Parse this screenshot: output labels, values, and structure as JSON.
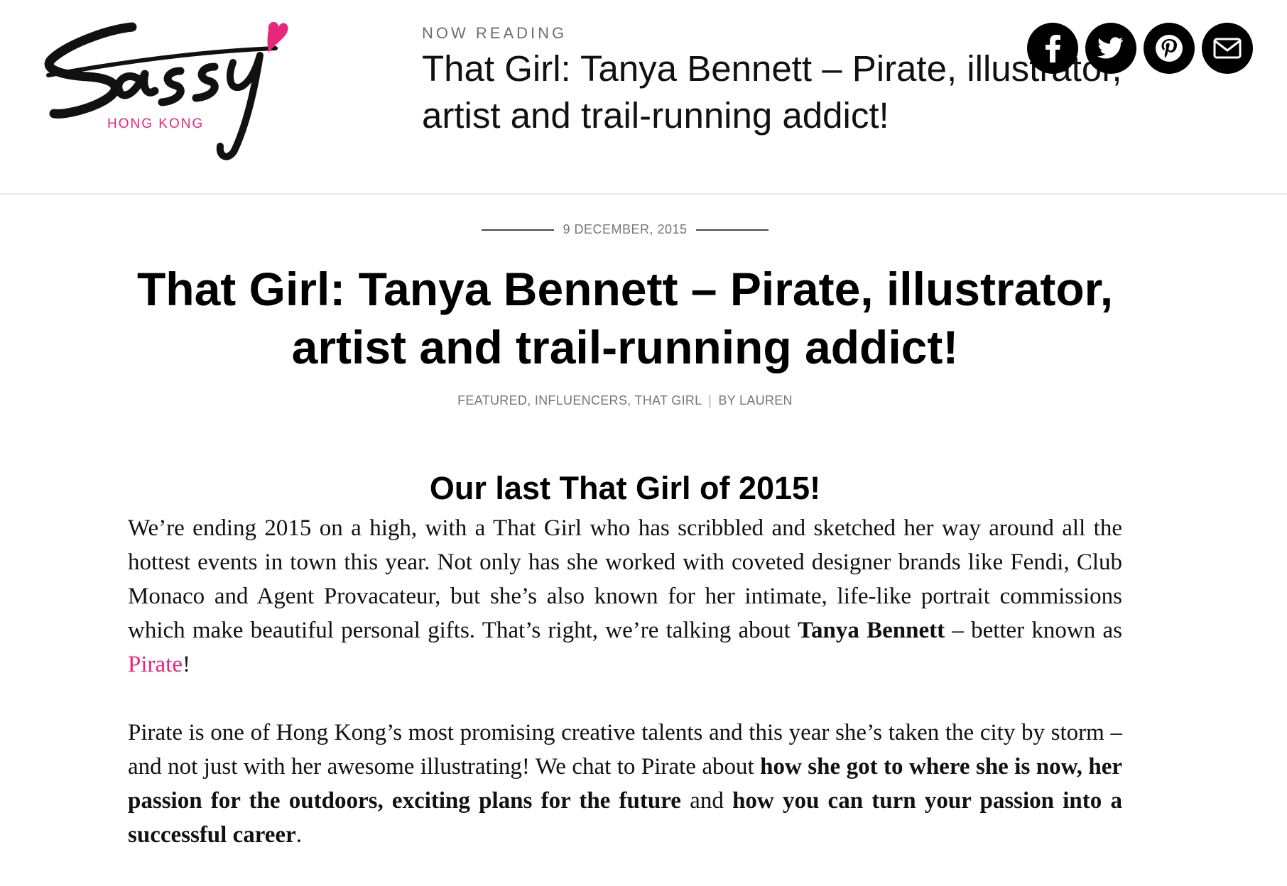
{
  "header": {
    "logo": {
      "wordmark": "Sassy",
      "sub": "HONG KONG",
      "accent_color": "#e8267c"
    },
    "now_reading": {
      "label": "NOW READING",
      "title": "That Girl: Tanya Bennett – Pirate, illustrator, artist and trail-running addict!"
    },
    "share": [
      {
        "name": "facebook",
        "icon": "facebook-icon"
      },
      {
        "name": "twitter",
        "icon": "twitter-icon"
      },
      {
        "name": "pinterest",
        "icon": "pinterest-icon"
      },
      {
        "name": "email",
        "icon": "envelope-icon"
      }
    ]
  },
  "article": {
    "date": "9 DECEMBER, 2015",
    "title_line1": "That Girl: Tanya Bennett – Pirate, illustrator,",
    "title_line2": "artist and trail-running addict!",
    "meta": {
      "categories": [
        "FEATURED",
        "INFLUENCERS",
        "THAT GIRL"
      ],
      "comma": ", ",
      "separator": "|",
      "byline": "BY LAUREN"
    },
    "subhead": "Our last That Girl of 2015!",
    "paragraph1": {
      "text": "We’re ending 2015 on a high, with a That Girl who has scribbled and sketched her way around all the hottest events in town this year. Not only has she worked with coveted designer brands like Fendi, Club Monaco and Agent Provacateur, but she’s also known for her intimate, life-like portrait commissions which make beautiful personal gifts. That’s right, we’re talking about ",
      "bold_name": "Tanya Bennett",
      "middle": " – better known as ",
      "link": "Pirate",
      "end": "!"
    },
    "paragraph2": {
      "text": "Pirate is one of Hong Kong’s most promising creative talents and this year she’s taken the city by storm – and not just with her awesome illustrating! We chat to Pirate about ",
      "bold1": "how she got to where she is now, her passion for the outdoors, exciting plans for the future",
      "middle": " and ",
      "bold2": "how you can turn your passion into a successful career",
      "end": "."
    }
  },
  "colors": {
    "accent": "#e8267c",
    "text": "#111111",
    "muted": "#777777"
  }
}
